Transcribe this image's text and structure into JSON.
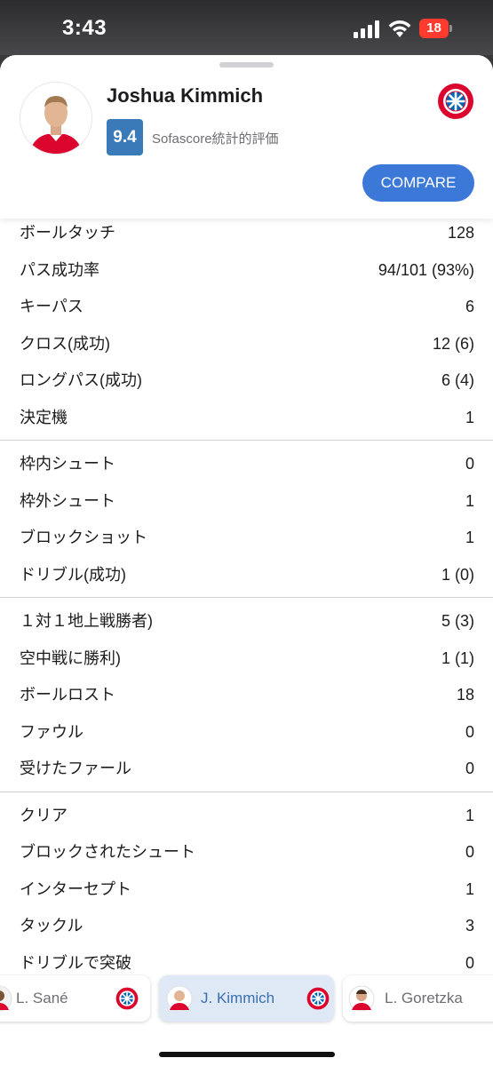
{
  "status_bar": {
    "time": "3:43",
    "battery": "18"
  },
  "player": {
    "name": "Joshua Kimmich",
    "rating": "9.4",
    "rating_label": "Sofascore統計的評価"
  },
  "compare_label": "COMPARE",
  "stats_groups": [
    [
      {
        "label": "ボールタッチ",
        "value": "128"
      },
      {
        "label": "パス成功率",
        "value": "94/101 (93%)"
      },
      {
        "label": "キーパス",
        "value": "6"
      },
      {
        "label": "クロス(成功)",
        "value": "12 (6)"
      },
      {
        "label": "ロングパス(成功)",
        "value": "6 (4)"
      },
      {
        "label": "決定機",
        "value": "1"
      }
    ],
    [
      {
        "label": "枠内シュート",
        "value": "0"
      },
      {
        "label": "枠外シュート",
        "value": "1"
      },
      {
        "label": "ブロックショット",
        "value": "1"
      },
      {
        "label": "ドリブル(成功)",
        "value": "1 (0)"
      }
    ],
    [
      {
        "label": "１対１地上戦勝者)",
        "value": "5 (3)"
      },
      {
        "label": "空中戦に勝利)",
        "value": "1 (1)"
      },
      {
        "label": "ボールロスト",
        "value": "18"
      },
      {
        "label": "ファウル",
        "value": "0"
      },
      {
        "label": "受けたファール",
        "value": "0"
      }
    ],
    [
      {
        "label": "クリア",
        "value": "1"
      },
      {
        "label": "ブロックされたシュート",
        "value": "0"
      },
      {
        "label": "インターセプト",
        "value": "1"
      },
      {
        "label": "タックル",
        "value": "3"
      },
      {
        "label": "ドリブルで突破",
        "value": "0"
      }
    ]
  ],
  "player_switcher": [
    {
      "name": "L. Sané",
      "selected": false
    },
    {
      "name": "J. Kimmich",
      "selected": true
    },
    {
      "name": "L. Goretzka",
      "selected": false
    }
  ],
  "colors": {
    "accent": "#3c78d8",
    "rating_bg": "#3a7ab8",
    "club_red": "#dc052d",
    "club_blue": "#0066b2"
  }
}
